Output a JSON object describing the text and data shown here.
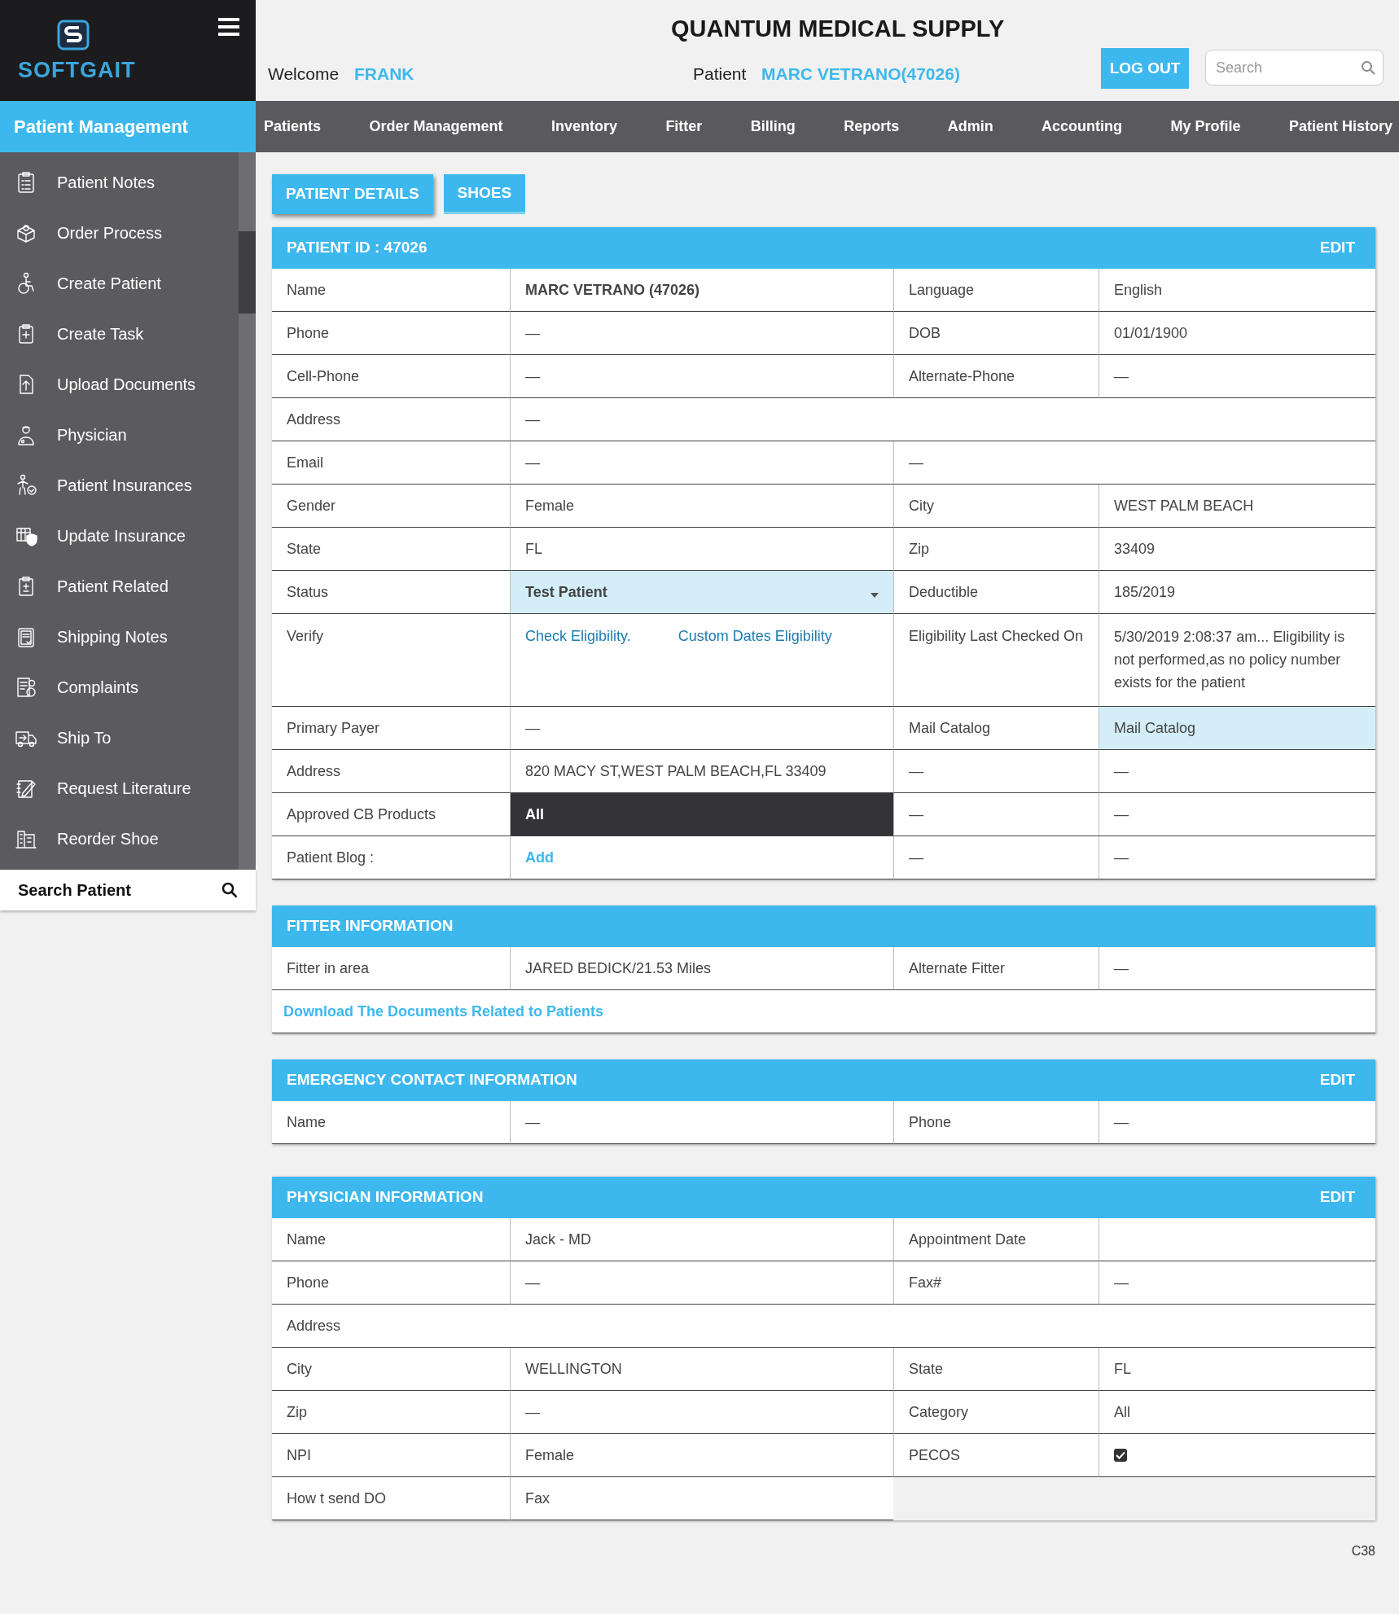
{
  "brand": {
    "name": "SOFTGAIT"
  },
  "header": {
    "title": "QUANTUM MEDICAL SUPPLY",
    "welcome_label": "Welcome",
    "user": "FRANK",
    "patient_label": "Patient",
    "patient": "MARC VETRANO(47026)",
    "logout": "LOG OUT",
    "search": {
      "placeholder": "Search"
    }
  },
  "nav": {
    "section": "Patient Management",
    "items": [
      "Patients",
      "Order Management",
      "Inventory",
      "Fitter",
      "Billing",
      "Reports",
      "Admin",
      "Accounting",
      "My Profile",
      "Patient History"
    ]
  },
  "sidebar": {
    "items": [
      "Patient Notes",
      "Order Process",
      "Create Patient",
      "Create Task",
      "Upload Documents",
      "Physician",
      "Patient Insurances",
      "Update Insurance",
      "Patient Related",
      "Shipping Notes",
      "Complaints",
      "Ship To",
      "Request Literature",
      "Reorder Shoe"
    ],
    "search": "Search Patient"
  },
  "tabs": [
    {
      "label": "PATIENT DETAILS",
      "selected": true
    },
    {
      "label": "SHOES",
      "selected": false
    }
  ],
  "sections": [
    {
      "title": "PATIENT ID : 47026",
      "edit": "EDIT",
      "rows": [
        {
          "kind": "quad",
          "cells": [
            {
              "kind": "label",
              "text": "Name"
            },
            {
              "kind": "strong",
              "text": "MARC VETRANO (47026)"
            },
            {
              "kind": "label",
              "text": "Language"
            },
            {
              "kind": "text",
              "text": "English"
            }
          ]
        },
        {
          "kind": "quad",
          "cells": [
            {
              "kind": "label",
              "text": "Phone"
            },
            {
              "kind": "text",
              "text": "—"
            },
            {
              "kind": "label",
              "text": "DOB"
            },
            {
              "kind": "text",
              "text": "01/01/1900"
            }
          ]
        },
        {
          "kind": "quad",
          "cells": [
            {
              "kind": "label",
              "text": "Cell-Phone"
            },
            {
              "kind": "text",
              "text": "—"
            },
            {
              "kind": "label",
              "text": "Alternate-Phone"
            },
            {
              "kind": "text",
              "text": "—"
            }
          ]
        },
        {
          "kind": "wide",
          "cells": [
            {
              "kind": "label",
              "text": "Address"
            },
            {
              "kind": "text",
              "text": "—"
            }
          ]
        },
        {
          "kind": "triple",
          "cells": [
            {
              "kind": "label",
              "text": "Email"
            },
            {
              "kind": "text",
              "text": "—"
            },
            {
              "kind": "text",
              "text": "—"
            }
          ]
        },
        {
          "kind": "quad",
          "cells": [
            {
              "kind": "label",
              "text": "Gender"
            },
            {
              "kind": "text",
              "text": "Female"
            },
            {
              "kind": "label",
              "text": "City"
            },
            {
              "kind": "text",
              "text": "WEST PALM BEACH"
            }
          ]
        },
        {
          "kind": "quad",
          "cells": [
            {
              "kind": "label",
              "text": "State"
            },
            {
              "kind": "text",
              "text": "FL"
            },
            {
              "kind": "label",
              "text": "Zip"
            },
            {
              "kind": "text",
              "text": "33409"
            }
          ]
        },
        {
          "kind": "quad",
          "cells": [
            {
              "kind": "label",
              "text": "Status"
            },
            {
              "kind": "select",
              "text": "Test Patient"
            },
            {
              "kind": "label",
              "text": "Deductible"
            },
            {
              "kind": "text",
              "text": "185/2019"
            }
          ]
        },
        {
          "kind": "quad",
          "cells": [
            {
              "kind": "label",
              "text": "Verify"
            },
            {
              "kind": "links",
              "links": [
                "Check Eligibility.",
                "Custom Dates Eligibility"
              ]
            },
            {
              "kind": "label",
              "text": "Eligibility Last Checked On"
            },
            {
              "kind": "text",
              "text": "5/30/2019 2:08:37 am... Eligibility  is not performed,as no policy number exists for the patient"
            }
          ]
        },
        {
          "kind": "quad",
          "cells": [
            {
              "kind": "label",
              "text": "Primary Payer"
            },
            {
              "kind": "text",
              "text": "—"
            },
            {
              "kind": "label",
              "text": "Mail Catalog"
            },
            {
              "kind": "highlight",
              "text": "Mail Catalog"
            }
          ]
        },
        {
          "kind": "quad",
          "cells": [
            {
              "kind": "label",
              "text": "Address"
            },
            {
              "kind": "text",
              "text": "820 MACY ST,WEST PALM BEACH,FL 33409"
            },
            {
              "kind": "text",
              "text": "—"
            },
            {
              "kind": "text",
              "text": "—"
            }
          ]
        },
        {
          "kind": "quad",
          "cells": [
            {
              "kind": "label",
              "text": "Approved CB Products"
            },
            {
              "kind": "dark",
              "text": "All"
            },
            {
              "kind": "text",
              "text": "—"
            },
            {
              "kind": "text",
              "text": "—"
            }
          ]
        },
        {
          "kind": "quad",
          "cells": [
            {
              "kind": "label",
              "text": "Patient Blog :"
            },
            {
              "kind": "action",
              "text": "Add"
            },
            {
              "kind": "text",
              "text": "—"
            },
            {
              "kind": "text",
              "text": "—"
            }
          ]
        }
      ]
    },
    {
      "title": "FITTER INFORMATION",
      "rows": [
        {
          "kind": "quad",
          "cells": [
            {
              "kind": "label",
              "text": "Fitter in area"
            },
            {
              "kind": "text",
              "text": "JARED BEDICK/21.53 Miles"
            },
            {
              "kind": "label",
              "text": "Alternate Fitter"
            },
            {
              "kind": "text",
              "text": "—"
            }
          ]
        },
        {
          "kind": "full",
          "cells": [
            {
              "kind": "download",
              "text": "Download The Documents Related to Patients"
            }
          ]
        }
      ]
    },
    {
      "title": "EMERGENCY CONTACT INFORMATION",
      "edit": "EDIT",
      "rows": [
        {
          "kind": "quad",
          "cells": [
            {
              "kind": "label",
              "text": "Name"
            },
            {
              "kind": "text",
              "text": "—"
            },
            {
              "kind": "label",
              "text": "Phone"
            },
            {
              "kind": "text",
              "text": "—"
            }
          ]
        }
      ]
    },
    {
      "title": "PHYSICIAN INFORMATION",
      "edit": "EDIT",
      "rows": [
        {
          "kind": "quad",
          "cells": [
            {
              "kind": "label",
              "text": "Name"
            },
            {
              "kind": "text",
              "text": "Jack - MD"
            },
            {
              "kind": "label",
              "text": "Appointment Date"
            },
            {
              "kind": "empty"
            }
          ]
        },
        {
          "kind": "quad",
          "cells": [
            {
              "kind": "label",
              "text": "Phone"
            },
            {
              "kind": "text",
              "text": "—"
            },
            {
              "kind": "label",
              "text": "Fax#"
            },
            {
              "kind": "text",
              "text": "—"
            }
          ]
        },
        {
          "kind": "full",
          "cells": [
            {
              "kind": "label",
              "text": "Address"
            }
          ]
        },
        {
          "kind": "quad",
          "cells": [
            {
              "kind": "label",
              "text": "City"
            },
            {
              "kind": "text",
              "text": "WELLINGTON"
            },
            {
              "kind": "label",
              "text": "State"
            },
            {
              "kind": "text",
              "text": "FL"
            }
          ]
        },
        {
          "kind": "quad",
          "cells": [
            {
              "kind": "label",
              "text": "Zip"
            },
            {
              "kind": "text",
              "text": "—"
            },
            {
              "kind": "label",
              "text": "Category"
            },
            {
              "kind": "text",
              "text": "All"
            }
          ]
        },
        {
          "kind": "quad",
          "cells": [
            {
              "kind": "label",
              "text": "NPI"
            },
            {
              "kind": "text",
              "text": "Female"
            },
            {
              "kind": "label",
              "text": "PECOS"
            },
            {
              "kind": "checkbox",
              "checked": true
            }
          ]
        },
        {
          "kind": "pair",
          "cells": [
            {
              "kind": "label",
              "text": "How t send DO"
            },
            {
              "kind": "text",
              "text": "Fax"
            }
          ]
        }
      ]
    }
  ],
  "footer": {
    "code": "C38"
  }
}
